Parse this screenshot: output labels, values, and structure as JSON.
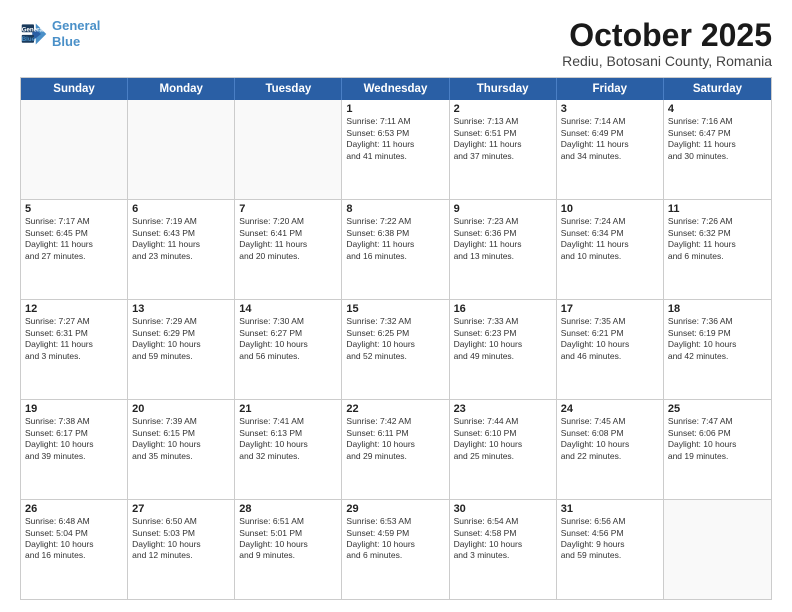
{
  "header": {
    "logo_line1": "General",
    "logo_line2": "Blue",
    "month": "October 2025",
    "location": "Rediu, Botosani County, Romania"
  },
  "weekdays": [
    "Sunday",
    "Monday",
    "Tuesday",
    "Wednesday",
    "Thursday",
    "Friday",
    "Saturday"
  ],
  "weeks": [
    [
      {
        "day": "",
        "info": "",
        "empty": true
      },
      {
        "day": "",
        "info": "",
        "empty": true
      },
      {
        "day": "",
        "info": "",
        "empty": true
      },
      {
        "day": "1",
        "info": "Sunrise: 7:11 AM\nSunset: 6:53 PM\nDaylight: 11 hours\nand 41 minutes.",
        "empty": false
      },
      {
        "day": "2",
        "info": "Sunrise: 7:13 AM\nSunset: 6:51 PM\nDaylight: 11 hours\nand 37 minutes.",
        "empty": false
      },
      {
        "day": "3",
        "info": "Sunrise: 7:14 AM\nSunset: 6:49 PM\nDaylight: 11 hours\nand 34 minutes.",
        "empty": false
      },
      {
        "day": "4",
        "info": "Sunrise: 7:16 AM\nSunset: 6:47 PM\nDaylight: 11 hours\nand 30 minutes.",
        "empty": false
      }
    ],
    [
      {
        "day": "5",
        "info": "Sunrise: 7:17 AM\nSunset: 6:45 PM\nDaylight: 11 hours\nand 27 minutes.",
        "empty": false
      },
      {
        "day": "6",
        "info": "Sunrise: 7:19 AM\nSunset: 6:43 PM\nDaylight: 11 hours\nand 23 minutes.",
        "empty": false
      },
      {
        "day": "7",
        "info": "Sunrise: 7:20 AM\nSunset: 6:41 PM\nDaylight: 11 hours\nand 20 minutes.",
        "empty": false
      },
      {
        "day": "8",
        "info": "Sunrise: 7:22 AM\nSunset: 6:38 PM\nDaylight: 11 hours\nand 16 minutes.",
        "empty": false
      },
      {
        "day": "9",
        "info": "Sunrise: 7:23 AM\nSunset: 6:36 PM\nDaylight: 11 hours\nand 13 minutes.",
        "empty": false
      },
      {
        "day": "10",
        "info": "Sunrise: 7:24 AM\nSunset: 6:34 PM\nDaylight: 11 hours\nand 10 minutes.",
        "empty": false
      },
      {
        "day": "11",
        "info": "Sunrise: 7:26 AM\nSunset: 6:32 PM\nDaylight: 11 hours\nand 6 minutes.",
        "empty": false
      }
    ],
    [
      {
        "day": "12",
        "info": "Sunrise: 7:27 AM\nSunset: 6:31 PM\nDaylight: 11 hours\nand 3 minutes.",
        "empty": false
      },
      {
        "day": "13",
        "info": "Sunrise: 7:29 AM\nSunset: 6:29 PM\nDaylight: 10 hours\nand 59 minutes.",
        "empty": false
      },
      {
        "day": "14",
        "info": "Sunrise: 7:30 AM\nSunset: 6:27 PM\nDaylight: 10 hours\nand 56 minutes.",
        "empty": false
      },
      {
        "day": "15",
        "info": "Sunrise: 7:32 AM\nSunset: 6:25 PM\nDaylight: 10 hours\nand 52 minutes.",
        "empty": false
      },
      {
        "day": "16",
        "info": "Sunrise: 7:33 AM\nSunset: 6:23 PM\nDaylight: 10 hours\nand 49 minutes.",
        "empty": false
      },
      {
        "day": "17",
        "info": "Sunrise: 7:35 AM\nSunset: 6:21 PM\nDaylight: 10 hours\nand 46 minutes.",
        "empty": false
      },
      {
        "day": "18",
        "info": "Sunrise: 7:36 AM\nSunset: 6:19 PM\nDaylight: 10 hours\nand 42 minutes.",
        "empty": false
      }
    ],
    [
      {
        "day": "19",
        "info": "Sunrise: 7:38 AM\nSunset: 6:17 PM\nDaylight: 10 hours\nand 39 minutes.",
        "empty": false
      },
      {
        "day": "20",
        "info": "Sunrise: 7:39 AM\nSunset: 6:15 PM\nDaylight: 10 hours\nand 35 minutes.",
        "empty": false
      },
      {
        "day": "21",
        "info": "Sunrise: 7:41 AM\nSunset: 6:13 PM\nDaylight: 10 hours\nand 32 minutes.",
        "empty": false
      },
      {
        "day": "22",
        "info": "Sunrise: 7:42 AM\nSunset: 6:11 PM\nDaylight: 10 hours\nand 29 minutes.",
        "empty": false
      },
      {
        "day": "23",
        "info": "Sunrise: 7:44 AM\nSunset: 6:10 PM\nDaylight: 10 hours\nand 25 minutes.",
        "empty": false
      },
      {
        "day": "24",
        "info": "Sunrise: 7:45 AM\nSunset: 6:08 PM\nDaylight: 10 hours\nand 22 minutes.",
        "empty": false
      },
      {
        "day": "25",
        "info": "Sunrise: 7:47 AM\nSunset: 6:06 PM\nDaylight: 10 hours\nand 19 minutes.",
        "empty": false
      }
    ],
    [
      {
        "day": "26",
        "info": "Sunrise: 6:48 AM\nSunset: 5:04 PM\nDaylight: 10 hours\nand 16 minutes.",
        "empty": false
      },
      {
        "day": "27",
        "info": "Sunrise: 6:50 AM\nSunset: 5:03 PM\nDaylight: 10 hours\nand 12 minutes.",
        "empty": false
      },
      {
        "day": "28",
        "info": "Sunrise: 6:51 AM\nSunset: 5:01 PM\nDaylight: 10 hours\nand 9 minutes.",
        "empty": false
      },
      {
        "day": "29",
        "info": "Sunrise: 6:53 AM\nSunset: 4:59 PM\nDaylight: 10 hours\nand 6 minutes.",
        "empty": false
      },
      {
        "day": "30",
        "info": "Sunrise: 6:54 AM\nSunset: 4:58 PM\nDaylight: 10 hours\nand 3 minutes.",
        "empty": false
      },
      {
        "day": "31",
        "info": "Sunrise: 6:56 AM\nSunset: 4:56 PM\nDaylight: 9 hours\nand 59 minutes.",
        "empty": false
      },
      {
        "day": "",
        "info": "",
        "empty": true
      }
    ]
  ]
}
